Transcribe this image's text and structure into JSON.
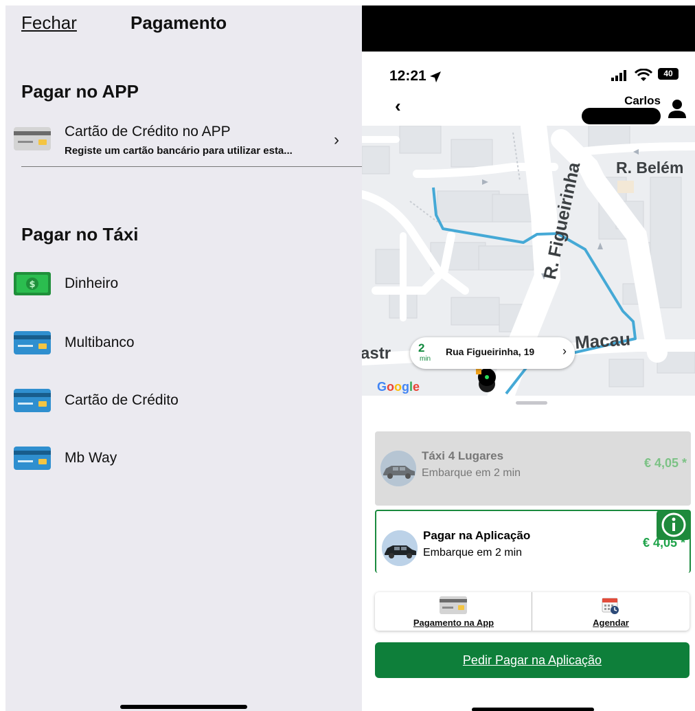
{
  "left_panel": {
    "close_label": "Fechar",
    "title": "Pagamento",
    "section_app": {
      "heading": "Pagar no APP",
      "item": {
        "label": "Cartão de Crédito no APP",
        "subtitle": "Registe um cartão bancário para utilizar esta...",
        "icon": "credit-card-gray-icon"
      }
    },
    "section_taxi": {
      "heading": "Pagar no Táxi",
      "items": [
        {
          "label": "Dinheiro",
          "icon": "cash-icon"
        },
        {
          "label": "Multibanco",
          "icon": "card-icon"
        },
        {
          "label": "Cartão de Crédito",
          "icon": "card-icon"
        },
        {
          "label": "Mb Way",
          "icon": "card-icon"
        }
      ]
    }
  },
  "right_panel": {
    "status_bar": {
      "time": "12:21",
      "battery": "40"
    },
    "nav": {
      "user_name": "Carlos"
    },
    "map": {
      "streets": [
        "R. Figueirinha",
        "R. Belém",
        "Macau",
        "astr"
      ],
      "google_label": "Google",
      "eta_value": "2",
      "eta_unit": "min",
      "address": "Rua Figueirinha, 19"
    },
    "options": [
      {
        "title": "Táxi 4 Lugares",
        "subtitle": "Embarque em 2 min",
        "price": "€ 4,05 *",
        "selected": false
      },
      {
        "title": "Pagar na Aplicação",
        "subtitle": "Embarque em 2 min",
        "price": "€ 4,05 *",
        "selected": true
      }
    ],
    "actions": {
      "payment_label": "Pagamento na App",
      "schedule_label": "Agendar",
      "cta_label": "Pedir Pagar na Aplicação"
    }
  },
  "colors": {
    "left_bg": "#ebeaf0",
    "accent_green": "#0e7f3a",
    "price_green_muted": "#7cc285",
    "price_green": "#1fa34a",
    "route_blue": "#45a9d6"
  }
}
